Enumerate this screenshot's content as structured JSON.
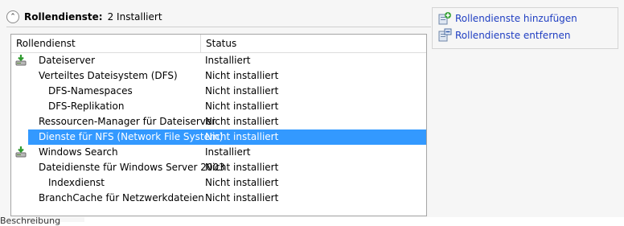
{
  "section": {
    "title": "Rollendienste:",
    "count": "2 Installiert"
  },
  "list": {
    "headers": {
      "name": "Rollendienst",
      "status": "Status"
    },
    "rows": [
      {
        "name": "Dateiserver",
        "status": "Installiert",
        "icon": "installed-server-icon"
      },
      {
        "name": "Verteiltes Dateisystem (DFS)",
        "status": "Nicht installiert"
      },
      {
        "name": "DFS-Namespaces",
        "status": "Nicht installiert"
      },
      {
        "name": "DFS-Replikation",
        "status": "Nicht installiert"
      },
      {
        "name": "Ressourcen-Manager für Dateiserver",
        "status": "Nicht installiert"
      },
      {
        "name": "Dienste für NFS (Network File System)",
        "status": "Nicht installiert"
      },
      {
        "name": "Windows Search",
        "status": "Installiert",
        "icon": "installed-server-icon"
      },
      {
        "name": "Dateidienste für Windows Server 2003",
        "status": "Nicht installiert"
      },
      {
        "name": "Indexdienst",
        "status": "Nicht installiert"
      },
      {
        "name": "BranchCache für Netzwerkdateien",
        "status": "Nicht installiert"
      }
    ]
  },
  "tasks": {
    "add": "Rollendienste hinzufügen",
    "remove": "Rollendienste entfernen"
  },
  "bottom": {
    "label": "Beschreibung"
  },
  "colors": {
    "selection": "#3399ff",
    "link": "#1f3ec2"
  }
}
